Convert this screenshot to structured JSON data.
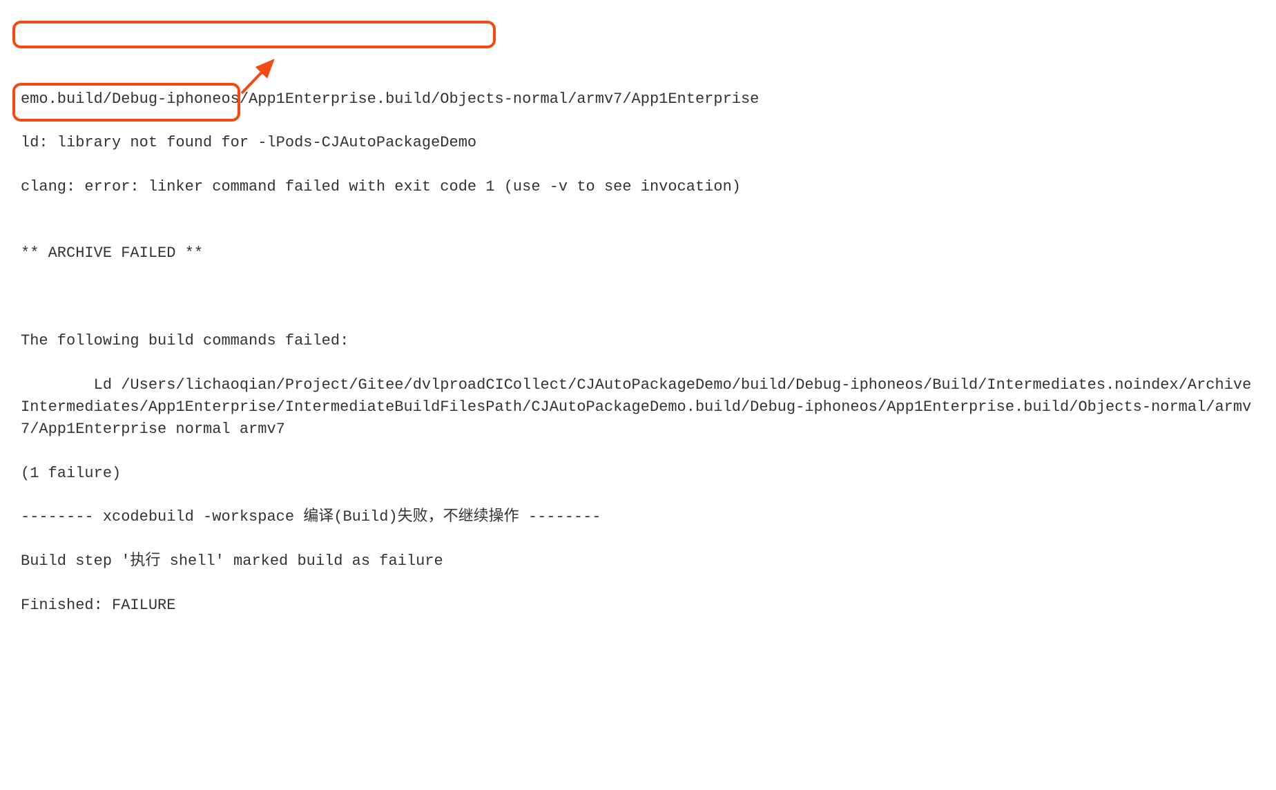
{
  "lines": {
    "l0": "emo.build/Debug-iphoneos/App1Enterprise.build/Objects-normal/armv7/App1Enterprise",
    "l1": "ld: library not found for -lPods-CJAutoPackageDemo",
    "l2": "clang: error: linker command failed with exit code 1 (use -v to see invocation)",
    "l3": "",
    "l4": "** ARCHIVE FAILED **",
    "l5": "",
    "l6": "",
    "l7": "The following build commands failed:",
    "l8": "        Ld /Users/lichaoqian/Project/Gitee/dvlproadCICollect/CJAutoPackageDemo/build/Debug-iphoneos/Build/Intermediates.noindex/ArchiveIntermediates/App1Enterprise/IntermediateBuildFilesPath/CJAutoPackageDemo.build/Debug-iphoneos/App1Enterprise.build/Objects-normal/armv7/App1Enterprise normal armv7",
    "l9": "(1 failure)",
    "l10": "-------- xcodebuild -workspace 编译(Build)失败，不继续操作 --------",
    "l11": "Build step '执行 shell' marked build as failure",
    "l12": "Finished: FAILURE"
  },
  "annotation": {
    "highlight_color": "#f44a12"
  }
}
